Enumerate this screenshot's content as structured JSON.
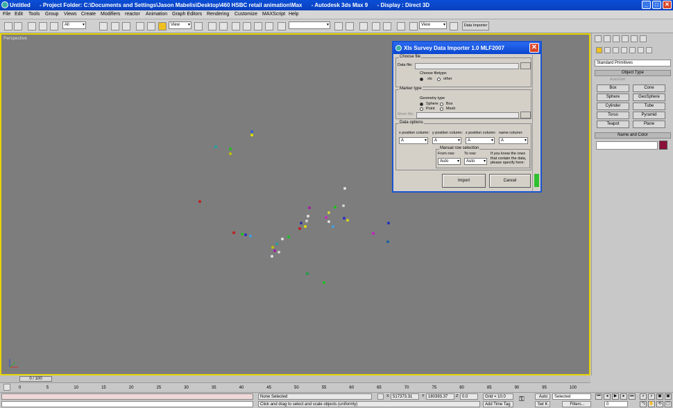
{
  "window": {
    "title": "Untitled      - Project Folder: C:\\Documents and Settings\\Jason Mabelis\\Desktop\\460 HSBC retail animation\\Max      - Autodesk 3ds Max 9      - Display : Direct 3D",
    "minimize_glyph": "_",
    "maximize_glyph": "□",
    "close_glyph": "✕"
  },
  "menu": [
    "File",
    "Edit",
    "Tools",
    "Group",
    "Views",
    "Create",
    "Modifiers",
    "reactor",
    "Animation",
    "Graph Editors",
    "Rendering",
    "Customize",
    "MAXScript",
    "Help"
  ],
  "toolbar": {
    "selection_filter": "All",
    "coord_system_1": "View",
    "named_sets": "",
    "coord_system_2": "View",
    "data_importer_label": "Data Importer"
  },
  "viewport": {
    "label": "Perspective",
    "points": [
      {
        "c": "#3060d0"
      },
      {
        "c": "#e0e000"
      },
      {
        "c": "#20c020"
      },
      {
        "c": "#c0c000"
      },
      {
        "c": "#20a0a0"
      },
      {
        "c": "#c02020"
      },
      {
        "c": "#e0e0e0"
      },
      {
        "c": "#d0d0d0"
      },
      {
        "c": "#3030c0"
      },
      {
        "c": "#20c020"
      },
      {
        "c": "#d0d040"
      },
      {
        "c": "#c030c0"
      },
      {
        "c": "#e0e0e0"
      },
      {
        "c": "#40a0e0"
      },
      {
        "c": "#d0d020"
      },
      {
        "c": "#a020a0"
      },
      {
        "c": "#e0e0e0"
      },
      {
        "c": "#d0d0d0"
      },
      {
        "c": "#e0e000"
      },
      {
        "c": "#3030a0"
      },
      {
        "c": "#c02020"
      },
      {
        "c": "#20c020"
      },
      {
        "c": "#e0e0e0"
      },
      {
        "c": "#20a0a0"
      },
      {
        "c": "#c0c000"
      },
      {
        "c": "#a020a0"
      },
      {
        "c": "#e0e0e0"
      },
      {
        "c": "#d0d0d0"
      },
      {
        "c": "#20c020"
      },
      {
        "c": "#3030c0"
      },
      {
        "c": "#c02020"
      },
      {
        "c": "#40a0e0"
      },
      {
        "c": "#c020c0"
      },
      {
        "c": "#2030c0"
      },
      {
        "c": "#2060a0"
      },
      {
        "c": "#20a040"
      },
      {
        "c": "#20c020"
      }
    ]
  },
  "command_panel": {
    "category": "Standard Primitives",
    "object_type_header": "Object Type",
    "autogrid_label": "AutoGrid",
    "primitives": [
      "Box",
      "Cone",
      "Sphere",
      "GeoSphere",
      "Cylinder",
      "Tube",
      "Torus",
      "Pyramid",
      "Teapot",
      "Plane"
    ],
    "name_color_header": "Name and Color",
    "object_name": "",
    "object_color": "#8a0f3a"
  },
  "timeline": {
    "frame_readout": "0 / 100",
    "ticks": [
      "0",
      "5",
      "10",
      "15",
      "20",
      "25",
      "30",
      "35",
      "40",
      "45",
      "50",
      "55",
      "60",
      "65",
      "70",
      "75",
      "80",
      "85",
      "90",
      "95",
      "100"
    ]
  },
  "status": {
    "selection": "None Selected",
    "prompt": "Click and drag to select and scale objects (uniformly)",
    "x_label": "X",
    "x_value": "517373.31",
    "y_label": "Y",
    "y_value": "180393.37",
    "z_label": "Z",
    "z_value": "0.0",
    "grid": "Grid = 10.0",
    "add_time_tag": "Add Time Tag",
    "auto_key": "Auto",
    "set_key": "Set K.",
    "key_mode": "Selected",
    "filters": "Filters...",
    "current_frame": "0"
  },
  "dialog": {
    "title": "Xls Survey Data Importer 1.0 MLF2007",
    "close_glyph": "✕",
    "choose_file": {
      "group_title": "Choose file",
      "data_file_label": "Data file:",
      "data_file_value": "",
      "filetype_label": "Choose filetype:",
      "opt_xls": "xls",
      "opt_other": "other"
    },
    "marker_type": {
      "group_title": "Marker type",
      "geometry_label": "Geometry type",
      "opt_sphere": "Sphere",
      "opt_box": "Box",
      "opt_point": "Point",
      "opt_mesh": "Mesh",
      "mesh_file_label": "Mesh file:",
      "mesh_file_value": ""
    },
    "data_options": {
      "group_title": "Data options",
      "x_col_label": "x position column:",
      "y_col_label": "y position column:",
      "z_col_label": "z position column:",
      "name_col_label": "name column:",
      "x_col": "A",
      "y_col": "A",
      "z_col": "A",
      "name_col": "A",
      "manual_title": "Manual row selection",
      "from_row_label": "From row:",
      "to_row_label": "To row:",
      "from_row": "Auto",
      "to_row": "Auto",
      "hint": "If you know the rows that contain the data, please specify here:"
    },
    "import_label": "Import",
    "cancel_label": "Cancel"
  }
}
